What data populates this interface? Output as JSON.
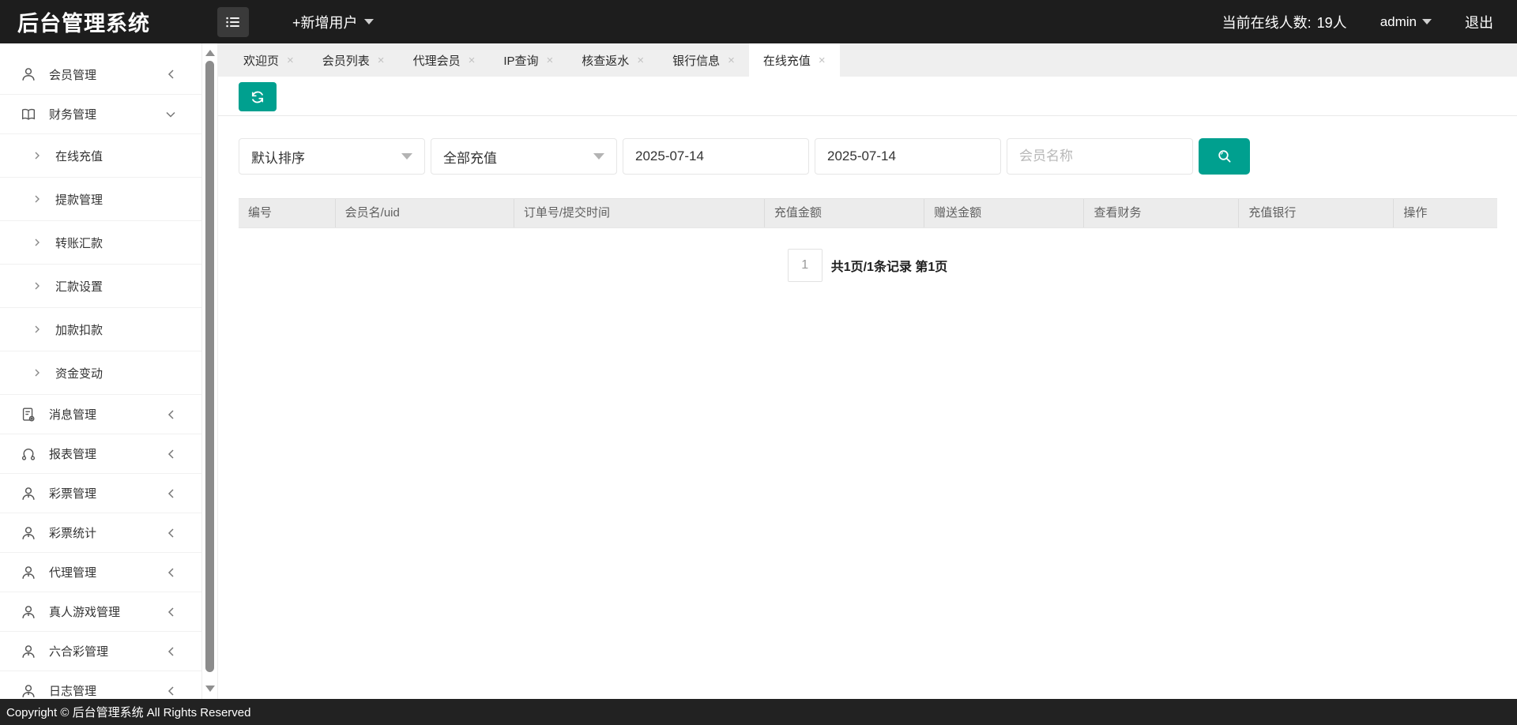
{
  "header": {
    "title": "后台管理系统",
    "add_user": "+新增用户",
    "online_label": "当前在线人数:",
    "online_count": "19人",
    "username": "admin",
    "logout": "退出"
  },
  "sidebar": {
    "groups": [
      {
        "label": "会员管理",
        "icon": "user-icon",
        "state": "collapsed"
      },
      {
        "label": "财务管理",
        "icon": "book-icon",
        "state": "expanded",
        "children": [
          {
            "label": "在线充值"
          },
          {
            "label": "提款管理"
          },
          {
            "label": "转账汇款"
          },
          {
            "label": "汇款设置"
          },
          {
            "label": "加款扣款"
          },
          {
            "label": "资金变动"
          }
        ]
      },
      {
        "label": "消息管理",
        "icon": "message-icon",
        "state": "collapsed"
      },
      {
        "label": "报表管理",
        "icon": "report-icon",
        "state": "collapsed"
      },
      {
        "label": "彩票管理",
        "icon": "user-icon",
        "state": "collapsed"
      },
      {
        "label": "彩票统计",
        "icon": "user-icon",
        "state": "collapsed"
      },
      {
        "label": "代理管理",
        "icon": "user-icon",
        "state": "collapsed"
      },
      {
        "label": "真人游戏管理",
        "icon": "user-icon",
        "state": "collapsed"
      },
      {
        "label": "六合彩管理",
        "icon": "user-icon",
        "state": "collapsed"
      },
      {
        "label": "日志管理",
        "icon": "user-icon",
        "state": "collapsed"
      }
    ]
  },
  "tabs": [
    {
      "label": "欢迎页",
      "active": false
    },
    {
      "label": "会员列表",
      "active": false
    },
    {
      "label": "代理会员",
      "active": false
    },
    {
      "label": "IP查询",
      "active": false
    },
    {
      "label": "核查返水",
      "active": false
    },
    {
      "label": "银行信息",
      "active": false
    },
    {
      "label": "在线充值",
      "active": true
    }
  ],
  "ui": {
    "tab_close": "×"
  },
  "filters": {
    "sort_selected": "默认排序",
    "type_selected": "全部充值",
    "date_from": "2025-07-14",
    "date_to": "2025-07-14",
    "member_placeholder": "会员名称"
  },
  "table": {
    "columns": [
      "编号",
      "会员名/uid",
      "订单号/提交时间",
      "充值金额",
      "赠送金额",
      "查看财务",
      "充值银行",
      "操作"
    ],
    "rows": []
  },
  "pagination": {
    "current_page": "1",
    "summary": "共1页/1条记录 第1页"
  },
  "footer": {
    "copyright": "Copyright © 后台管理系统 All Rights Reserved"
  },
  "colors": {
    "accent": "#00a08f",
    "header_bg": "#1d1d1d",
    "tabbar_bg": "#efefef",
    "table_header_bg": "#ececec"
  }
}
